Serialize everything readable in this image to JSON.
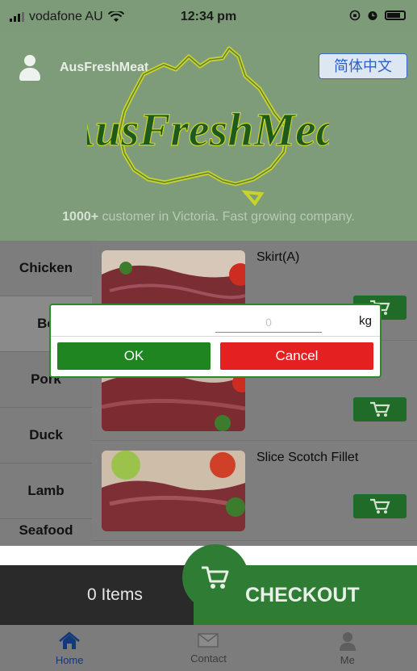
{
  "status_bar": {
    "carrier": "vodafone AU",
    "time": "12:34 pm"
  },
  "header": {
    "brand": "AusFreshMeat",
    "language_button": "简体中文",
    "tagline_bold": "1000+",
    "tagline_rest": " customer in Victoria. Fast growing company."
  },
  "categories": [
    {
      "label": "Chicken"
    },
    {
      "label": "Be"
    },
    {
      "label": "Pork"
    },
    {
      "label": "Duck"
    },
    {
      "label": "Lamb"
    },
    {
      "label": "Seafood"
    }
  ],
  "products": [
    {
      "name": "Skirt(A)"
    },
    {
      "name": ""
    },
    {
      "name": "Slice Scotch Fillet"
    }
  ],
  "dialog": {
    "quantity_placeholder": "0",
    "unit": "kg",
    "ok_label": "OK",
    "cancel_label": "Cancel"
  },
  "checkout": {
    "items_label": "0 Items",
    "checkout_label": "CHECKOUT"
  },
  "tabs": [
    {
      "label": "Home",
      "icon": "home-icon"
    },
    {
      "label": "Contact",
      "icon": "mail-icon"
    },
    {
      "label": "Me",
      "icon": "person-icon"
    }
  ],
  "colors": {
    "brand_green": "#2f7d34",
    "ok_green": "#1f8520",
    "cancel_red": "#e52020",
    "active_tab_blue": "#123a7a"
  }
}
